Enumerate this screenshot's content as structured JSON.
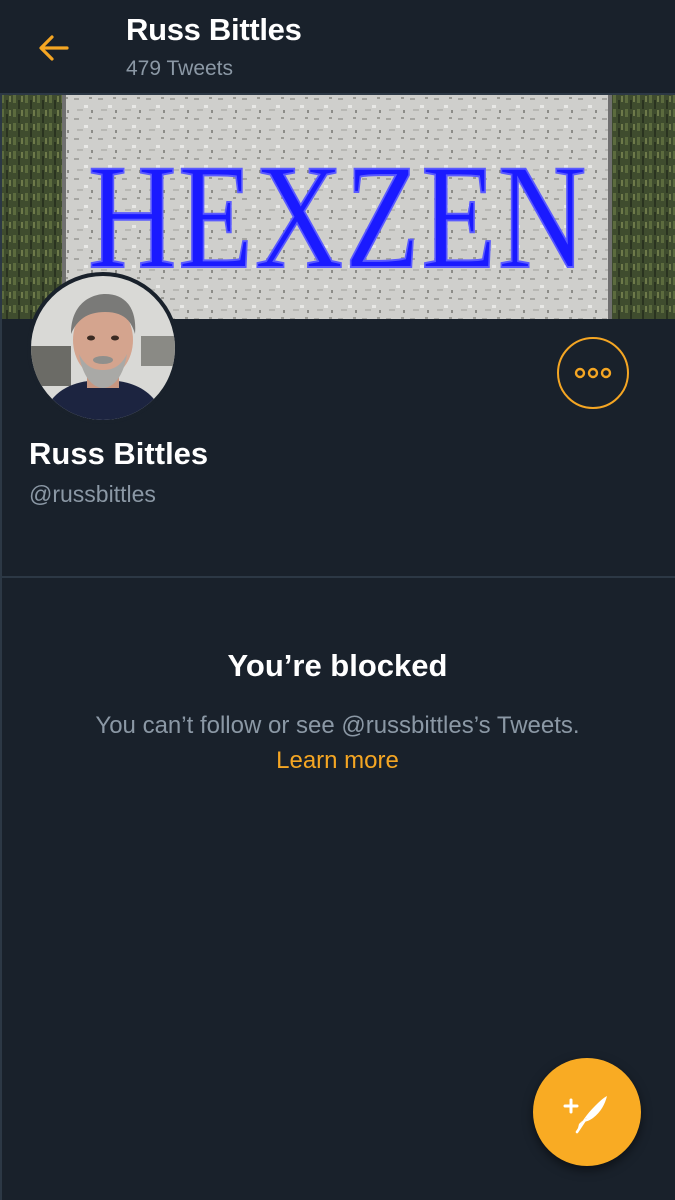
{
  "header": {
    "title": "Russ Bittles",
    "subtitle": "479 Tweets",
    "back_icon": "arrow-left-icon"
  },
  "banner": {
    "text": "HEXZEN",
    "text_color": "#1a1aff"
  },
  "profile": {
    "name": "Russ Bittles",
    "handle": "@russbittles",
    "more_icon": "more-options-icon"
  },
  "blocked": {
    "title": "You’re blocked",
    "message": "You can’t follow or see @russbittles’s Tweets.",
    "link": "Learn more"
  },
  "fab": {
    "icon": "compose-tweet-icon"
  },
  "colors": {
    "accent": "#f5a623",
    "background": "#19212b",
    "secondary_text": "#8b98a5",
    "divider": "#2c3845"
  }
}
